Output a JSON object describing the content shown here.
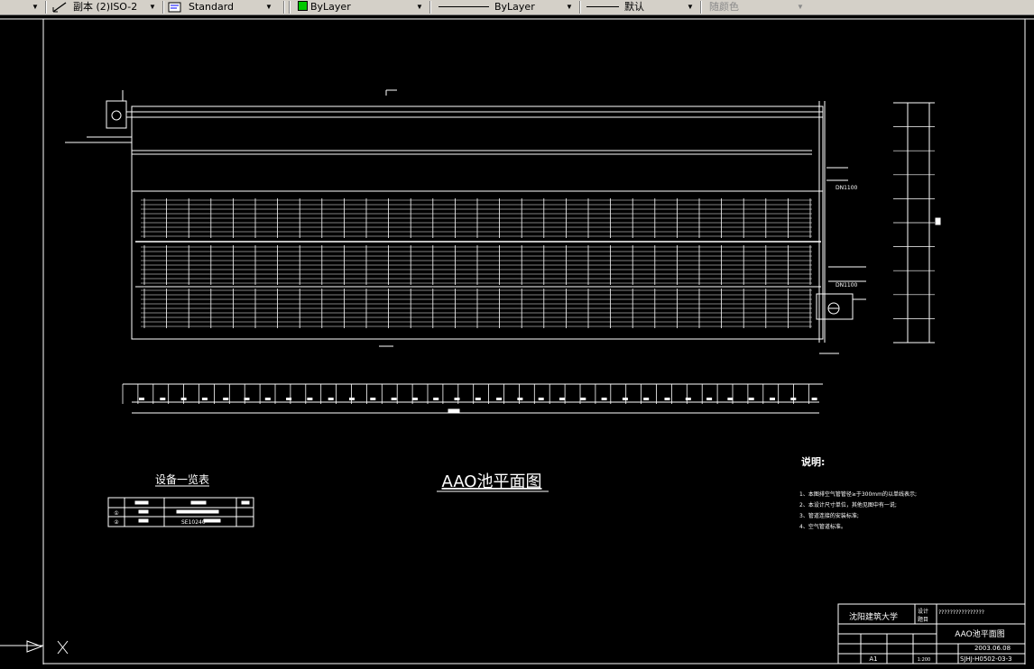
{
  "toolbar": {
    "dimstyle_value": "副本 (2)ISO-2",
    "textstyle_value": "Standard",
    "layer_color_value": "ByLayer",
    "linetype_value": "ByLayer",
    "lineweight_value": "默认",
    "plotstyle_value": "随颜色",
    "layer_color_swatch": "#00c800"
  },
  "drawing": {
    "title": "AAO池平面图",
    "equipment_table": {
      "title": "设备一览表",
      "rows": [
        "①",
        "②"
      ],
      "row2_spec": "SE10240"
    },
    "notes": {
      "title": "说明:",
      "items": [
        "1、本图排空气管管径≥于300mm的以单线表示;",
        "2、本设计尺寸单位，其他见图中有一说;",
        "3、管道连接的安装标准;",
        "4、空气管道标准。"
      ]
    },
    "labels": {
      "dn_top": "DN1100",
      "dn_mid": "DN1100"
    },
    "title_block": {
      "school": "沈阳建筑大学",
      "design_label": "设计",
      "project_label": "题目",
      "project_value": "????????????????",
      "drawing_name": "AAO池平面图",
      "date": "2003.06.08",
      "scale": "1:200",
      "sheet_size": "A1",
      "number": "SJHJ-H0502-03-3"
    }
  },
  "colors": {
    "background": "#000000",
    "lines": "#ffffff",
    "toolbar": "#d4d0c8"
  }
}
